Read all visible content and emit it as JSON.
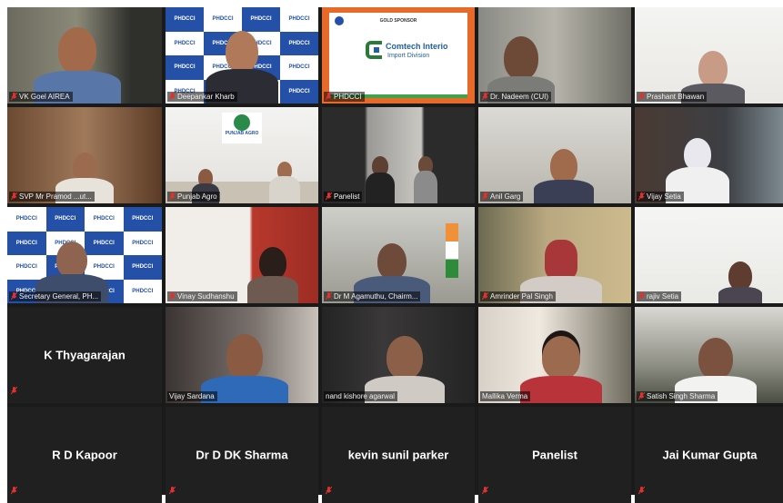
{
  "tiles": [
    {
      "label": "VK Goel AIREA"
    },
    {
      "label": "Deepankar Kharb"
    },
    {
      "label": "PHDCCI",
      "sponsor_title": "GOLD SPONSOR",
      "sponsor_name": "Comtech Interio",
      "sponsor_sub": "Import Division"
    },
    {
      "label": "Dr. Nadeem (CUI)"
    },
    {
      "label": "Prashant Bhawan"
    },
    {
      "label": "SVP Mr Pramod ...ut..."
    },
    {
      "label": "Punjab Agro",
      "sign_text": "PUNJAB AGRO"
    },
    {
      "label": "Panelist"
    },
    {
      "label": "Anil Garg"
    },
    {
      "label": "Vijay Setia"
    },
    {
      "label": "Secretary General, PH..."
    },
    {
      "label": "Vinay Sudhanshu"
    },
    {
      "label": "Dr M Agamuthu, Chairm..."
    },
    {
      "label": "Amrinder Pal Singh"
    },
    {
      "label": "rajiv Setia"
    },
    {
      "label": "K Thyagarajan"
    },
    {
      "label": "Vijay Sardana"
    },
    {
      "label": "nand kishore agarwal"
    },
    {
      "label": "Mallika Verma"
    },
    {
      "label": "Satish Singh Sharma"
    },
    {
      "label": "R D Kapoor"
    },
    {
      "label": "Dr D DK Sharma"
    },
    {
      "label": "kevin sunil parker"
    },
    {
      "label": "Panelist"
    },
    {
      "label": "Jai Kumar Gupta"
    }
  ],
  "logo_text": "PHDCCI",
  "colors": {
    "speaking_border": "#c7dd4a",
    "mic_muted": "#e0312f",
    "background": "#1a1a1a"
  }
}
